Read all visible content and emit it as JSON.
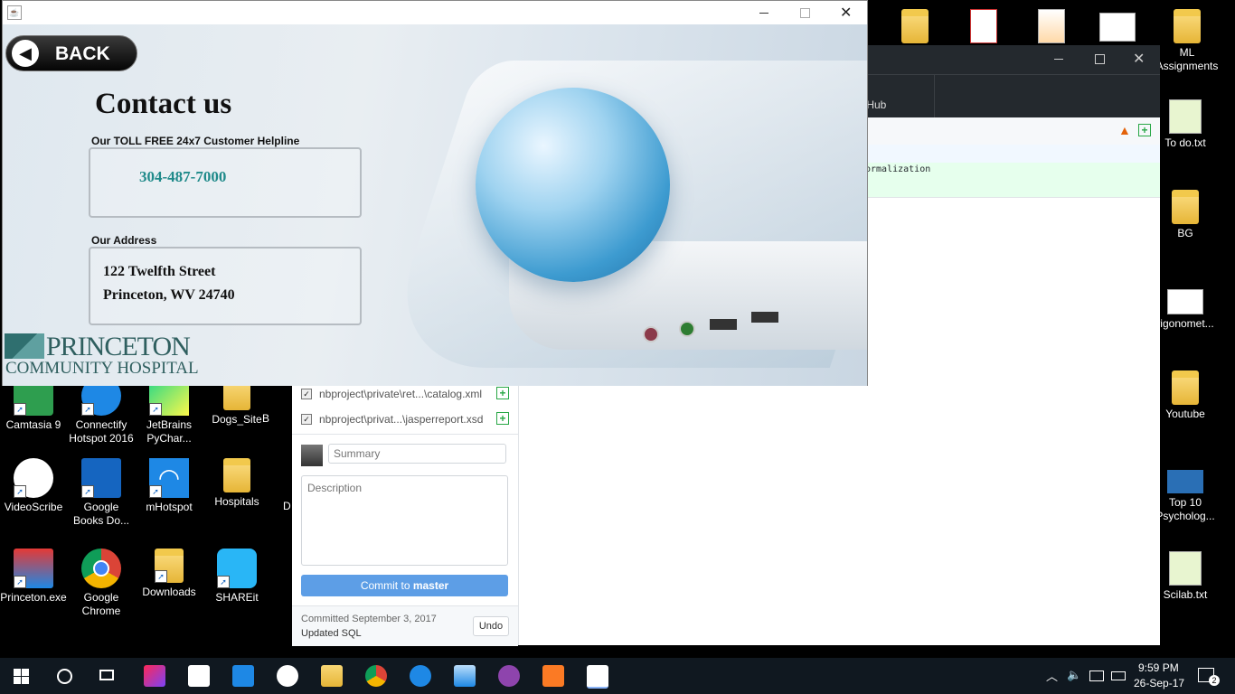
{
  "desktop": {
    "right_icons": [
      {
        "label": "ML Assignments"
      },
      {
        "label": "To do.txt"
      },
      {
        "label": "BG"
      },
      {
        "label": "rigonomet..."
      },
      {
        "label": "Youtube"
      },
      {
        "label": "Top 10 Psycholog..."
      },
      {
        "label": "Scilab.txt"
      }
    ],
    "left_icons": [
      {
        "label": "Camtasia 9"
      },
      {
        "label": "Connectify Hotspot 2016"
      },
      {
        "label": "JetBrains PyChar..."
      },
      {
        "label": "Dogs_Site"
      },
      {
        "label": "B"
      },
      {
        "label": "VideoScribe"
      },
      {
        "label": "Google Books Do..."
      },
      {
        "label": "mHotspot"
      },
      {
        "label": "Hospitals"
      },
      {
        "label": "D"
      },
      {
        "label": "Princeton.exe"
      },
      {
        "label": "Google Chrome"
      },
      {
        "label": "Downloads"
      },
      {
        "label": "SHAREit"
      }
    ]
  },
  "github": {
    "tab_partial": "tHub",
    "diff_partial": "ormalization",
    "changes": [
      {
        "path": "nbproject\\private\\ret...\\catalog.xml"
      },
      {
        "path": "nbproject\\privat...\\jasperreport.xsd"
      }
    ],
    "summary_placeholder": "Summary",
    "description_placeholder": "Description",
    "commit_label_pre": "Commit to ",
    "commit_label_branch": "master",
    "last_commit_date": "Committed September 3, 2017",
    "last_commit_msg": "Updated SQL",
    "undo_label": "Undo"
  },
  "app": {
    "back_label": "BACK",
    "title": "Contact us",
    "helpline_label": "Our TOLL FREE 24x7 Customer Helpline",
    "phone": "304-487-7000",
    "address_label": "Our Address",
    "address_line1": "122 Twelfth Street",
    "address_line2": "Princeton, WV 24740",
    "logo_line1": "PRINCETON",
    "logo_line2": "COMMUNITY HOSPITAL",
    "colors": {
      "phone": "#1f8a8a",
      "logo": "#2f5f5f"
    }
  },
  "taskbar": {
    "time": "9:59 PM",
    "date": "26-Sep-17",
    "notifications": "2"
  }
}
